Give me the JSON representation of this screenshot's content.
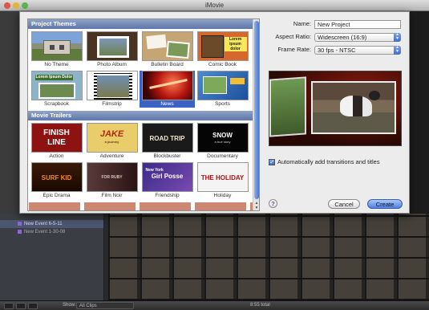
{
  "window": {
    "title": "iMovie"
  },
  "project_themes": {
    "header": "Project Themes",
    "items": [
      {
        "label": "No Theme",
        "icon": "house-photo-thumbnail"
      },
      {
        "label": "Photo Album",
        "icon": "photo-album-thumbnail"
      },
      {
        "label": "Bulletin Board",
        "icon": "bulletin-board-thumbnail"
      },
      {
        "label": "Comic Book",
        "icon": "comic-book-thumbnail",
        "thumb_text": "Lorem ipsum dolor"
      },
      {
        "label": "Scrapbook",
        "icon": "scrapbook-thumbnail",
        "thumb_text": "Lorem Ipsum Dolor"
      },
      {
        "label": "Filmstrip",
        "icon": "filmstrip-thumbnail"
      },
      {
        "label": "News",
        "icon": "news-thumbnail",
        "selected": true
      },
      {
        "label": "Sports",
        "icon": "sports-thumbnail"
      }
    ]
  },
  "movie_trailers": {
    "header": "Movie Trailers",
    "items": [
      {
        "label": "Action",
        "thumb_text": "FINISH LINE",
        "bg": "#8e1212",
        "fg": "#ffffff"
      },
      {
        "label": "Adventure",
        "thumb_text": "JAKE",
        "sub_text": "a journey",
        "bg": "#e9cd6a",
        "fg": "#b02a10"
      },
      {
        "label": "Blockbuster",
        "thumb_text": "ROAD TRIP",
        "bg": "#1a1a1a",
        "fg": "#f0e6d0"
      },
      {
        "label": "Documentary",
        "thumb_text": "SNOW",
        "sub_text": "a true story",
        "bg": "#050505",
        "fg": "#ffffff"
      },
      {
        "label": "Epic Drama",
        "thumb_text": "SURF KID",
        "bg": "#2a1005",
        "fg": "#f08a20"
      },
      {
        "label": "Film Noir",
        "thumb_text": "FOR RUBY",
        "bg": "#3a1f1f",
        "fg": "#d8c8b8"
      },
      {
        "label": "Friendship",
        "thumb_text": "Girl Posse",
        "sub_text": "New York",
        "bg": "#3a2a8a",
        "fg": "#ffffff"
      },
      {
        "label": "Holiday",
        "thumb_text": "THE HOLIDAY",
        "bg": "#f4f4f4",
        "fg": "#b01010"
      }
    ]
  },
  "form": {
    "name_label": "Name:",
    "name_value": "New Project",
    "aspect_label": "Aspect Ratio:",
    "aspect_value": "Widescreen (16:9)",
    "framerate_label": "Frame Rate:",
    "framerate_value": "30 fps - NTSC",
    "auto_transitions_label": "Automatically add transitions and titles",
    "auto_transitions_checked": true
  },
  "buttons": {
    "help": "?",
    "cancel": "Cancel",
    "create": "Create"
  },
  "background": {
    "events": [
      "New Event 6-5-11",
      "New Event 1-30-08"
    ],
    "show_label": "Show:",
    "show_value": "All Clips",
    "total": "8:55 total"
  },
  "colors": {
    "selection": "#3b63c4",
    "section_header": "#6c82b2",
    "create_button": "#4d7fe0"
  }
}
